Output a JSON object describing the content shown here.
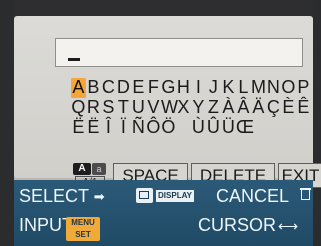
{
  "keyboard": {
    "rows": [
      [
        "A",
        "B",
        "C",
        "D",
        "E",
        "F",
        "G",
        "H",
        "I",
        "J",
        "K",
        "L",
        "M",
        "N",
        "O",
        "P"
      ],
      [
        "Q",
        "R",
        "S",
        "T",
        "U",
        "V",
        "W",
        "X",
        "Y",
        "Z",
        "À",
        "Â",
        "Ä",
        "Ç",
        "È",
        "Ê"
      ],
      [
        "Ë",
        "Ë",
        "Î",
        "Ï",
        "Ñ",
        "Ô",
        "Ö",
        " ",
        "Ù",
        "Û",
        "Ü",
        "Œ"
      ]
    ],
    "selected": "A",
    "mode": {
      "active": "A",
      "inactive": "a",
      "label": "A/1"
    },
    "buttons": {
      "space": "SPACE",
      "delete": "DELETE",
      "exit": "EXIT"
    }
  },
  "bottom_bar": {
    "select": "SELECT",
    "display_text": "DISPLAY",
    "cancel": "CANCEL",
    "input": "INPUT",
    "menu_set_top": "MENU",
    "menu_set_bottom": "SET",
    "cursor": "CURSOR"
  },
  "icons": {
    "select_arrow": "select-arrow-icon",
    "display": "display-icon",
    "trash": "trash-icon",
    "menu_set": "menu-set-icon",
    "cursor_arrows": "cursor-arrows-icon"
  }
}
